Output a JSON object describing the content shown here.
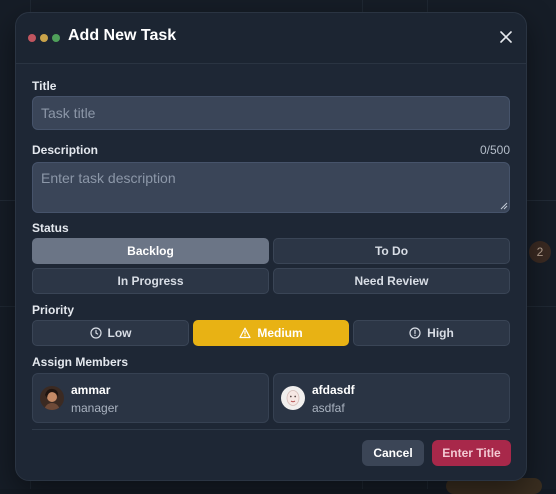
{
  "window": {
    "title": "Add New Task",
    "close_icon": "close-icon"
  },
  "form": {
    "title_label": "Title",
    "title_placeholder": "Task title",
    "title_value": "",
    "description_label": "Description",
    "description_counter": "0/500",
    "description_placeholder": "Enter task description",
    "description_value": "",
    "status_label": "Status",
    "status_options": [
      "Backlog",
      "To Do",
      "In Progress",
      "Need Review"
    ],
    "status_selected": "Backlog",
    "priority_label": "Priority",
    "priority_options": [
      {
        "label": "Low",
        "icon": "clock-icon"
      },
      {
        "label": "Medium",
        "icon": "warning-icon"
      },
      {
        "label": "High",
        "icon": "alert-circle-icon"
      }
    ],
    "priority_selected": "Medium",
    "members_label": "Assign Members",
    "members": [
      {
        "name": "ammar",
        "role": "manager"
      },
      {
        "name": "afdasdf",
        "role": "asdfaf"
      }
    ]
  },
  "footer": {
    "cancel_label": "Cancel",
    "submit_label": "Enter Title"
  },
  "background": {
    "badge_count": "2"
  },
  "colors": {
    "accent_priority": "#e8b214",
    "accent_submit": "#a8284a",
    "status_active": "#6b7586"
  }
}
